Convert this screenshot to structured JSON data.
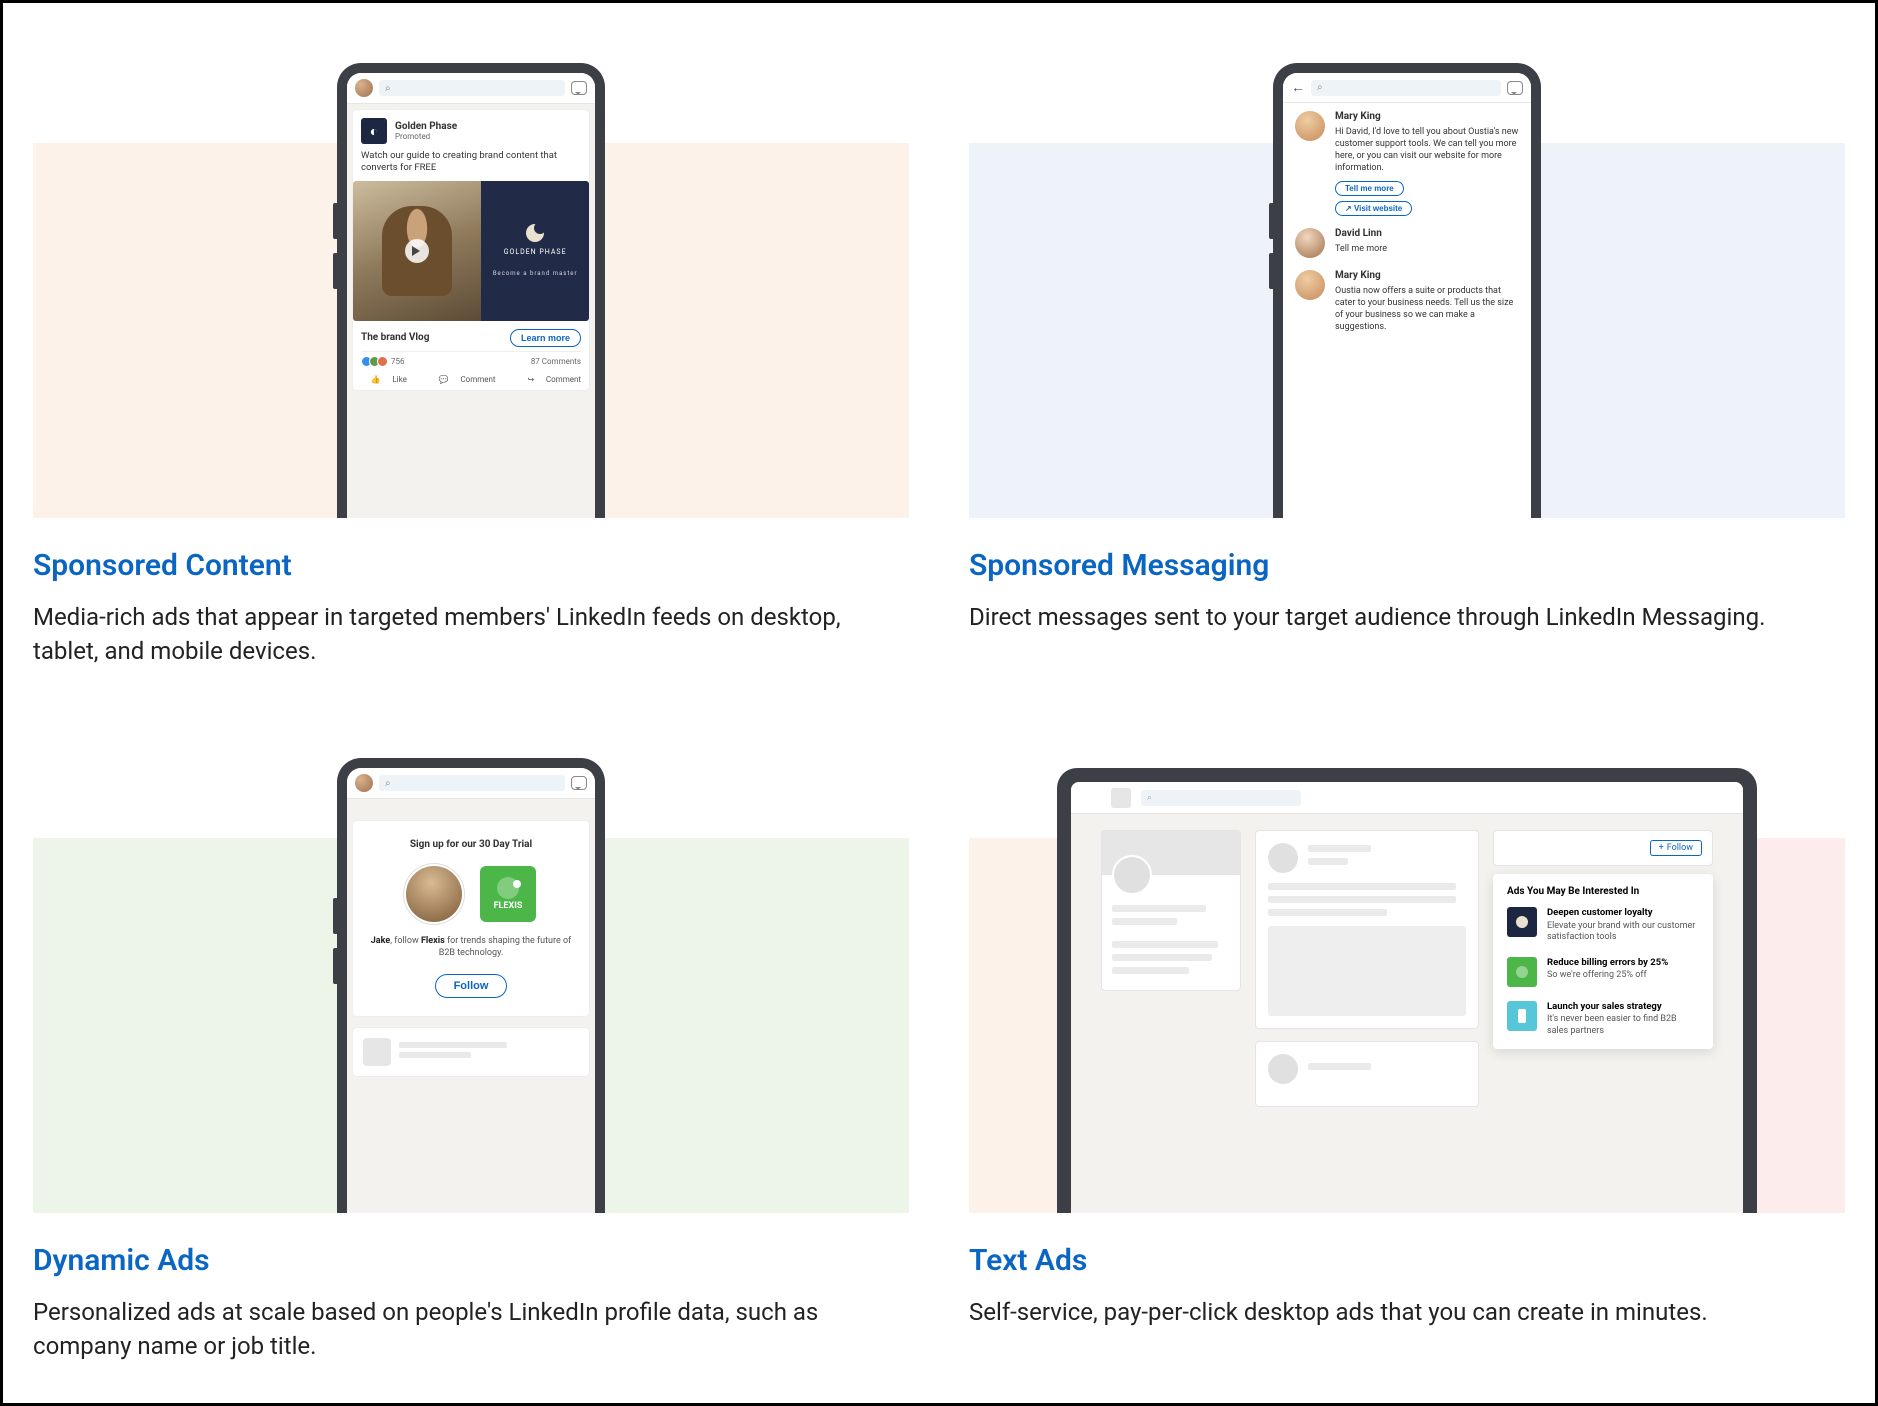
{
  "cards": {
    "sponsored_content": {
      "title": "Sponsored Content",
      "desc": "Media-rich ads that appear in targeted members' LinkedIn feeds on desktop, tablet, and mobile devices.",
      "company": "Golden Phase",
      "promoted": "Promoted",
      "post_text": "Watch our guide to creating brand content that converts for FREE",
      "brand_label": "GOLDEN PHASE",
      "brand_caption": "Become a brand master",
      "vlog_title": "The brand Vlog",
      "cta": "Learn more",
      "reaction_count": "756",
      "comments_label": "87 Comments",
      "like": "Like",
      "comment": "Comment",
      "share": "Comment"
    },
    "sponsored_messaging": {
      "title": "Sponsored Messaging",
      "desc": "Direct messages sent to your target audience through LinkedIn Messaging.",
      "m1_name": "Mary King",
      "m1_text": "Hi David, I'd love to tell you about Oustia's new customer support tools. We can tell you more here, or you can visit our website for more information.",
      "btn_more": "Tell me more",
      "btn_visit": "Visit website",
      "m2_name": "David Linn",
      "m2_text": "Tell me more",
      "m3_name": "Mary King",
      "m3_text": "Oustia now offers a suite or products that cater to your business needs. Tell us the size of your business so we can make a suggestions."
    },
    "dynamic_ads": {
      "title": "Dynamic Ads",
      "desc": "Personalized ads at scale based on people's LinkedIn profile data, such as company name or job title.",
      "headline": "Sign up for our 30 Day Trial",
      "logo_text": "FLEXIS",
      "body_prefix": "Jake",
      "body_mid": ", follow ",
      "body_brand": "Flexis",
      "body_suffix": " for trends shaping the future of B2B technology.",
      "follow": "Follow"
    },
    "text_ads": {
      "title": "Text Ads",
      "desc": "Self-service, pay-per-click desktop ads that you can create in minutes.",
      "follow_btn": "Follow",
      "panel_head": "Ads You May Be Interested In",
      "ad1_title": "Deepen customer loyalty",
      "ad1_sub": "Elevate your brand with our customer satisfaction tools",
      "ad2_title": "Reduce billing errors by 25%",
      "ad2_sub": "So we're offering 25% off",
      "ad3_title": "Launch your sales strategy",
      "ad3_sub": "It's never been easier to find B2B sales partners"
    }
  }
}
